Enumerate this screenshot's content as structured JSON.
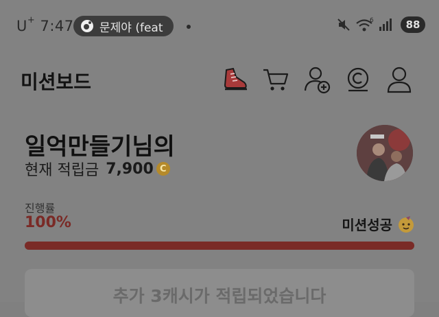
{
  "status_bar": {
    "carrier": "U",
    "carrier_mark": "+",
    "time": "7:47",
    "media_text": "문제야 (feat",
    "wifi_badge": "6",
    "battery": "88"
  },
  "header": {
    "title": "미션보드"
  },
  "icons": [
    "shoe-icon",
    "cart-icon",
    "add-friend-icon",
    "coin-c-icon",
    "profile-icon"
  ],
  "user": {
    "name": "일억만들기님의",
    "balance_label": "현재 적립금",
    "balance_value": "7,900",
    "coin_symbol": "C"
  },
  "progress": {
    "label": "진행률",
    "value_text": "100%",
    "value": 100,
    "status": "미션성공"
  },
  "notice": {
    "text": "추가 3캐시가 적립되었습니다"
  },
  "colors": {
    "accent": "#7a2b27",
    "coin": "#b58a2a",
    "shoe": "#a83a3a"
  }
}
